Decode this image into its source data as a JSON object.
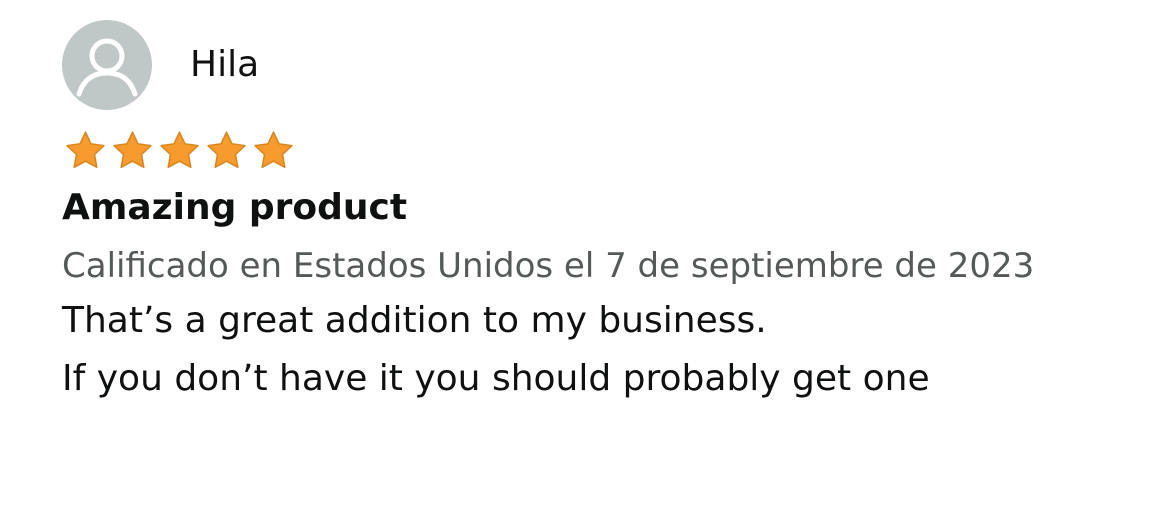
{
  "review": {
    "profile": {
      "name": "Hila",
      "avatar_icon": "user-silhouette-icon",
      "avatar_bg": "#bfc7c7"
    },
    "rating": {
      "stars": 5,
      "max": 5,
      "star_icon": "star-icon",
      "color": "#f79b2e"
    },
    "title": "Amazing product",
    "meta": "Calificado en Estados Unidos el 7 de septiembre de 2023",
    "body": [
      "That’s a great addition to my business.",
      "If you don’t have it you should probably get one"
    ]
  }
}
